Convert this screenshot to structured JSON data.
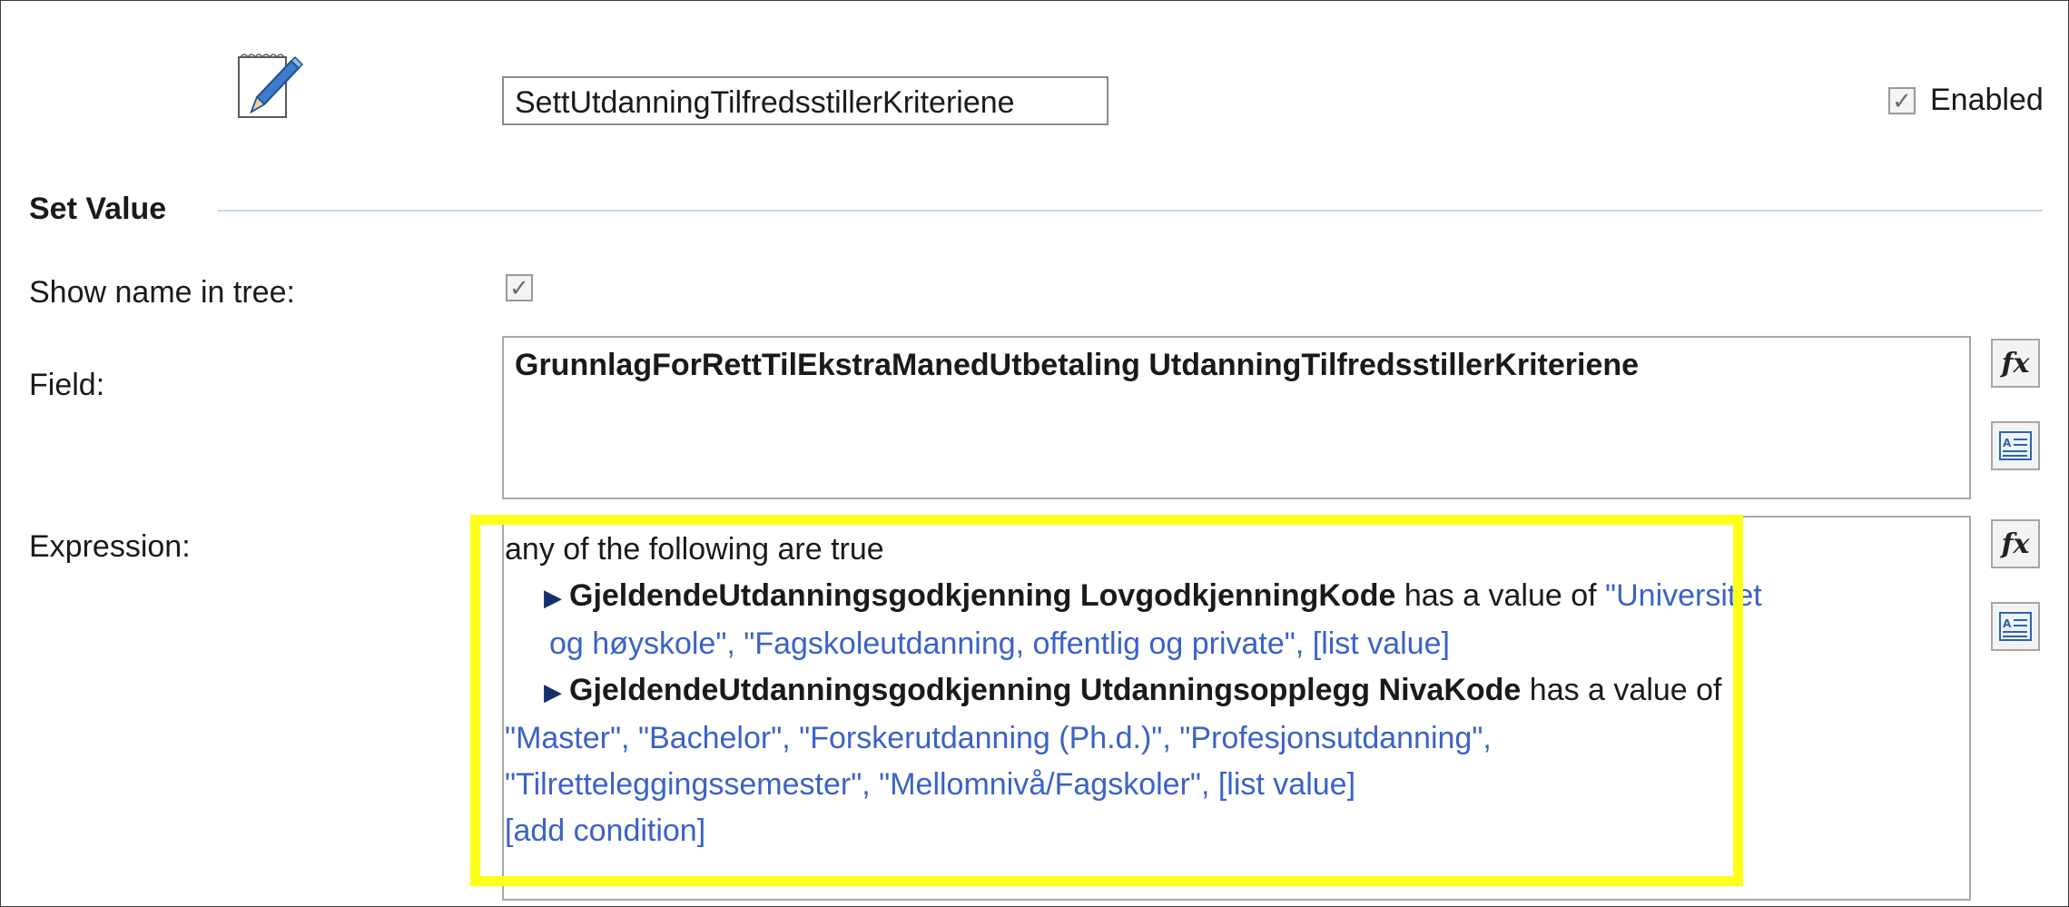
{
  "header": {
    "rule_name": "SettUtdanningTilfredsstillerKriteriene",
    "enabled_label": "Enabled"
  },
  "section": {
    "title": "Set Value"
  },
  "labels": {
    "show_name": "Show name in tree:",
    "field": "Field:",
    "expression": "Expression:"
  },
  "field": {
    "value": "GrunnlagForRettTilEkstraManedUtbetaling UtdanningTilfredsstillerKriteriene"
  },
  "expression": {
    "header": "any of the following are true",
    "condition1": {
      "field": "GjeldendeUtdanningsgodkjenning LovgodkjenningKode",
      "operator": " has a value of ",
      "value_part1": "\"Universitet",
      "value_part2": "og høyskole\", \"Fagskoleutdanning, offentlig og private\", [list value]"
    },
    "condition2": {
      "field": "GjeldendeUtdanningsgodkjenning Utdanningsopplegg NivaKode",
      "operator": " has a value of",
      "values_line1": "\"Master\", \"Bachelor\", \"Forskerutdanning (Ph.d.)\", \"Profesjonsutdanning\",",
      "values_line2": "\"Tilretteleggingssemester\", \"Mellomnivå/Fagskoler\", [list value]"
    },
    "add_condition": "[add condition]"
  },
  "buttons": {
    "fx_label": "fx"
  },
  "colors": {
    "link_blue": "#3a62c8",
    "highlight_yellow": "#ffff1a",
    "accent_line": "#c9d7e6"
  }
}
